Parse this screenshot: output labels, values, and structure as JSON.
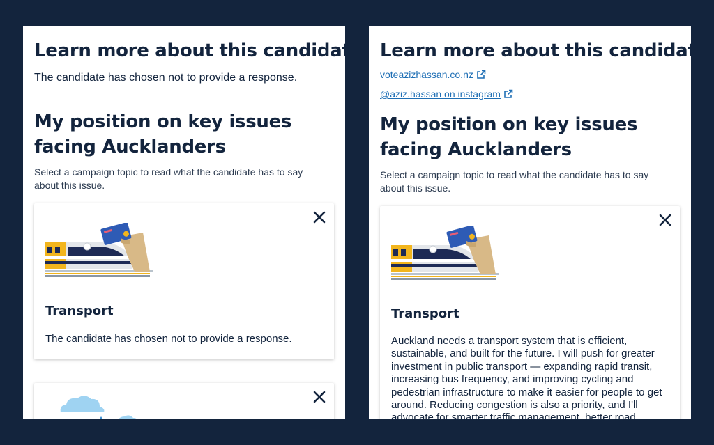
{
  "left_panel": {
    "learn_title": "Learn more about this candidate",
    "no_response": "The candidate has chosen not to provide a response.",
    "position_title": "My position on key issues facing Aucklanders",
    "select_text": "Select a campaign topic to read what the candidate has to say about this issue.",
    "card": {
      "title": "Transport",
      "body": "The candidate has chosen not to provide a response."
    }
  },
  "right_panel": {
    "learn_title": "Learn more about this candidate",
    "links": [
      {
        "label": "voteazizhassan.co.nz"
      },
      {
        "label": "@aziz.hassan on instagram"
      }
    ],
    "position_title": "My position on key issues facing Aucklanders",
    "select_text": "Select a campaign topic to read what the candidate has to say about this issue.",
    "card": {
      "title": "Transport",
      "body": "Auckland needs a transport system that is efficient, sustainable, and built for the future. I will push for greater investment in public transport — expanding rapid transit, increasing bus frequency, and improving cycling and pedestrian infrastructure to make it easier for people to get around. Reducing congestion is also a priority, and I'll advocate for smarter traffic management, better road"
    }
  },
  "icons": {
    "close": "close-icon",
    "external_link": "external-link-icon",
    "transport_illustration": "train-card-illustration",
    "weather_illustration": "cloud-illustration"
  },
  "colors": {
    "background": "#13243d",
    "text": "#13243d",
    "link": "#1f6fb5",
    "card_blue": "#2e5bb5",
    "train_yellow": "#f2b51d",
    "hand": "#d8b987"
  }
}
